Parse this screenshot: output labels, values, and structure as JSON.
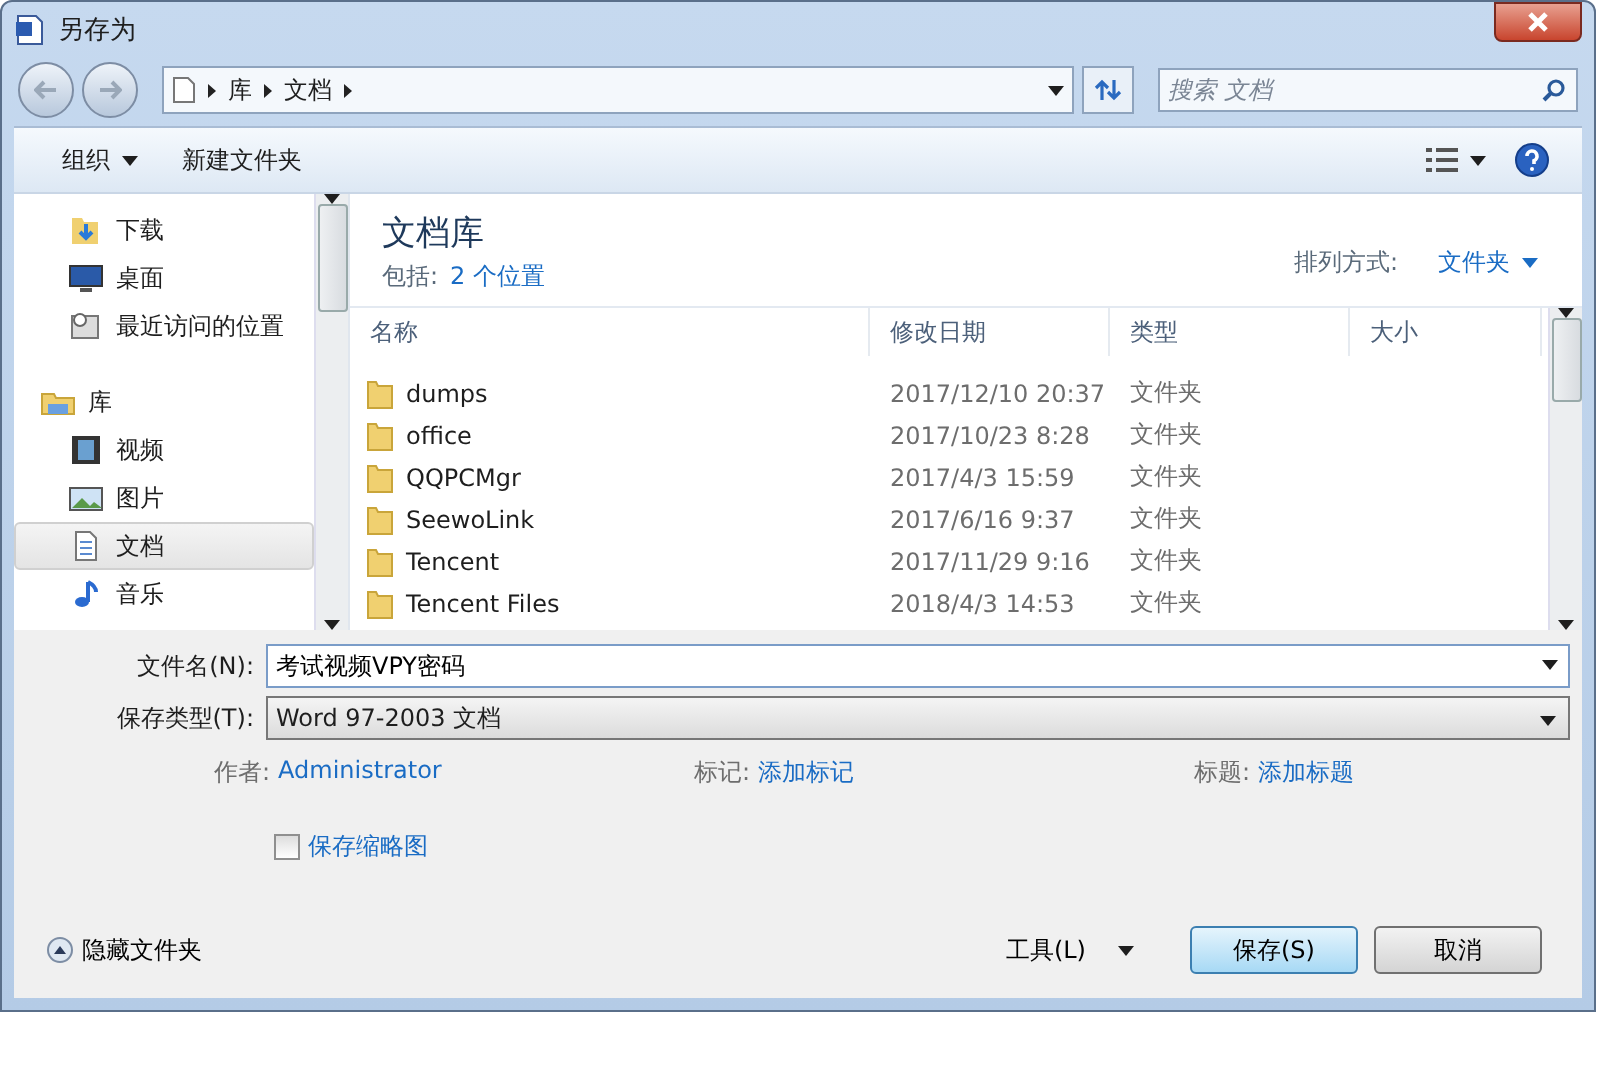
{
  "window": {
    "title": "另存为"
  },
  "address": {
    "crumbs": [
      "库",
      "文档"
    ]
  },
  "search": {
    "placeholder": "搜索 文档"
  },
  "toolbar": {
    "organize": "组织",
    "new_folder": "新建文件夹"
  },
  "sidebar": {
    "items": [
      {
        "label": "下载",
        "kind": "download",
        "selected": false
      },
      {
        "label": "桌面",
        "kind": "desktop",
        "selected": false
      },
      {
        "label": "最近访问的位置",
        "kind": "recent",
        "selected": false
      },
      {
        "label": "库",
        "kind": "library",
        "selected": false,
        "children": [
          {
            "label": "视频",
            "kind": "video",
            "selected": false
          },
          {
            "label": "图片",
            "kind": "picture",
            "selected": false
          },
          {
            "label": "文档",
            "kind": "document",
            "selected": true
          },
          {
            "label": "音乐",
            "kind": "music",
            "selected": false
          }
        ]
      }
    ]
  },
  "library": {
    "title": "文档库",
    "includes_label": "包括:",
    "includes_link": "2 个位置",
    "arrange_label": "排列方式:",
    "arrange_value": "文件夹"
  },
  "table": {
    "columns": [
      "名称",
      "修改日期",
      "类型",
      "大小"
    ],
    "rows": [
      {
        "name": "dumps",
        "date": "2017/12/10 20:37",
        "type": "文件夹"
      },
      {
        "name": "office",
        "date": "2017/10/23 8:28",
        "type": "文件夹"
      },
      {
        "name": "QQPCMgr",
        "date": "2017/4/3 15:59",
        "type": "文件夹"
      },
      {
        "name": "SeewoLink",
        "date": "2017/6/16 9:37",
        "type": "文件夹"
      },
      {
        "name": "Tencent",
        "date": "2017/11/29 9:16",
        "type": "文件夹"
      },
      {
        "name": "Tencent Files",
        "date": "2018/4/3 14:53",
        "type": "文件夹"
      }
    ]
  },
  "form": {
    "filename_label": "文件名(N):",
    "filename": "考试视频VPY密码",
    "type_label": "保存类型(T):",
    "type": "Word 97-2003 文档"
  },
  "meta": [
    {
      "label": "作者:",
      "value": "Administrator"
    },
    {
      "label": "标记:",
      "value": "添加标记"
    },
    {
      "label": "标题:",
      "value": "添加标题"
    }
  ],
  "thumbnail": {
    "label": "保存缩略图",
    "checked": false
  },
  "footer": {
    "hide_folders": "隐藏文件夹",
    "tools": "工具(L)",
    "save": "保存(S)",
    "cancel": "取消"
  }
}
